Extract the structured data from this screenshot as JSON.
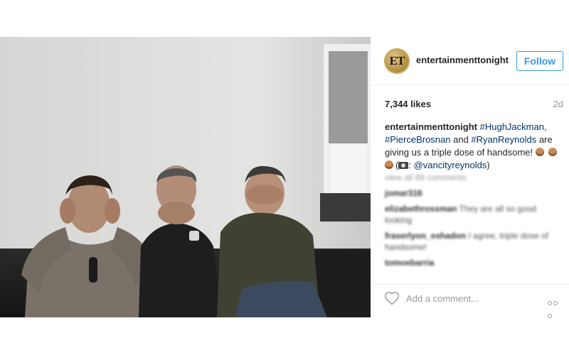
{
  "post": {
    "image_alt": "Three men covering ears, mouth and eyes on a couch"
  },
  "header": {
    "avatar_text": "ET",
    "username": "entertainmenttonight",
    "follow_label": "Follow"
  },
  "meta": {
    "likes": "7,344 likes",
    "age": "2d"
  },
  "caption": {
    "user": "entertainmenttonight",
    "tag1": "#HughJackman",
    "sep1": ",",
    "tag2": "#PierceBrosnan",
    "mid": " and ",
    "tag3": "#RyanReynolds",
    "text": " are giving us a triple dose of handsome!",
    "credit_prefix": ":",
    "credit": "@vancityreynolds",
    "credit_suffix": ")"
  },
  "comments": {
    "load_more": "view all 89 comments",
    "items": [
      {
        "user": "jomar316",
        "text": ""
      },
      {
        "user": "elizabethrossman",
        "text": "They are all so good looking"
      },
      {
        "user": "fraserlyon_eshadon",
        "text": "I agree, triple dose of handsome!"
      },
      {
        "user": "tomoebarria",
        "text": ""
      }
    ]
  },
  "compose": {
    "placeholder": "Add a comment..."
  },
  "icons": {
    "heart": "heart-icon",
    "more": "more-options-icon"
  },
  "colors": {
    "link": "#003569",
    "follow": "#3897f0"
  }
}
